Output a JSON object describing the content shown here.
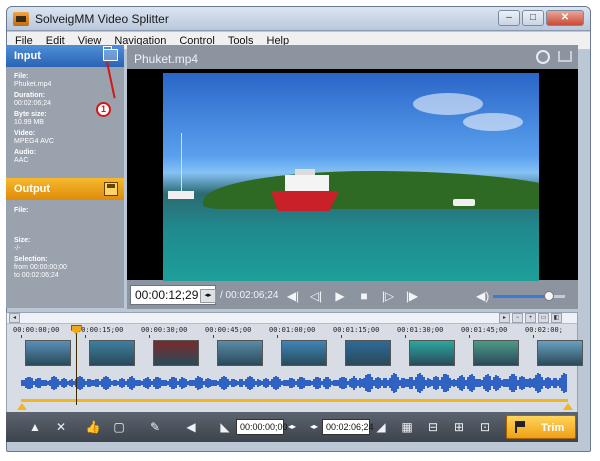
{
  "window": {
    "title": "SolveigMM Video Splitter"
  },
  "menu": [
    "File",
    "Edit",
    "View",
    "Navigation",
    "Control",
    "Tools",
    "Help"
  ],
  "input": {
    "label": "Input",
    "fields": [
      {
        "key": "File:",
        "value": "Phuket.mp4"
      },
      {
        "key": "Duration:",
        "value": "00:02:06;24"
      },
      {
        "key": "Byte size:",
        "value": "10.99 MB"
      },
      {
        "key": "Video:",
        "value": "MPEG4 AVC"
      },
      {
        "key": "Audio:",
        "value": "AAC"
      }
    ]
  },
  "callout": "1",
  "output": {
    "label": "Output",
    "file_label": "File:",
    "size_label": "Size:",
    "size_value": "-/-",
    "selection_label": "Selection:",
    "from_label": "from",
    "from_value": "00:00:00;00",
    "to_label": "to",
    "to_value": "00:02:06;24"
  },
  "player": {
    "file_title": "Phuket.mp4",
    "timecode": "00:00:12;29",
    "duration": "/ 00:02:06;24",
    "volume_percent": 78
  },
  "timeline": {
    "ticks": [
      "00:00:00;00",
      "00:00:15;00",
      "00:00:30;00",
      "00:00:45;00",
      "00:01:00;00",
      "00:01:15;00",
      "00:01:30;00",
      "00:01:45;00",
      "00:02:00;"
    ],
    "thumb_colors": [
      "#5a8fb8",
      "#3d7fa0",
      "#7a2a2a",
      "#5c8aa8",
      "#3e86b8",
      "#2f6a9a",
      "#2ba8a0",
      "#4d9a88",
      "#6aa0c0"
    ],
    "cursor_fraction": 0.1
  },
  "bottom": {
    "start_time": "00:00:00;00",
    "end_time": "00:02:06;24",
    "trim_label": "Trim"
  },
  "icons": {
    "open": "folder-icon",
    "save": "save-icon",
    "snapshot": "camera-icon",
    "cart": "cart-icon"
  }
}
